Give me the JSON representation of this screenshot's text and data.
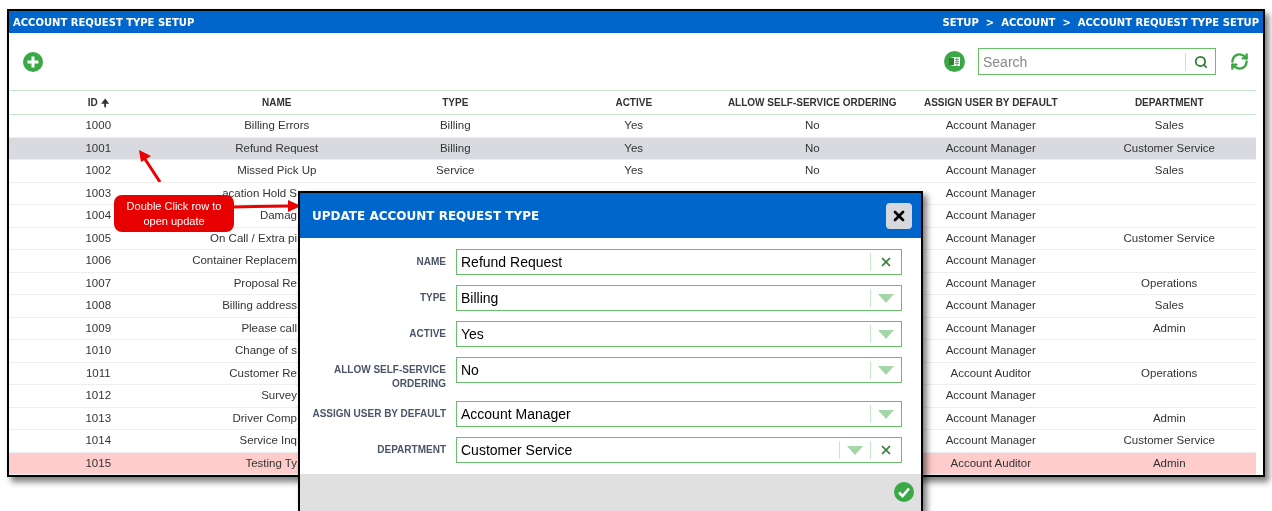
{
  "window": {
    "title": "ACCOUNT REQUEST TYPE SETUP",
    "breadcrumb": [
      "SETUP",
      "ACCOUNT",
      "ACCOUNT REQUEST TYPE SETUP"
    ],
    "separator": ">"
  },
  "search": {
    "placeholder": "Search"
  },
  "table": {
    "columns": [
      {
        "label": "ID",
        "sort_arrow": "🠉"
      },
      {
        "label": "NAME"
      },
      {
        "label": "TYPE"
      },
      {
        "label": "ACTIVE"
      },
      {
        "label": "ALLOW SELF-SERVICE ORDERING"
      },
      {
        "label": "ASSIGN USER BY DEFAULT"
      },
      {
        "label": "DEPARTMENT"
      }
    ],
    "rows": [
      {
        "cells": [
          "1000",
          "Billing Errors",
          "Billing",
          "Yes",
          "No",
          "Account Manager",
          "Sales"
        ],
        "selected": false,
        "alert": false,
        "cut_by_dialog": false
      },
      {
        "cells": [
          "1001",
          "Refund Request",
          "Billing",
          "Yes",
          "No",
          "Account Manager",
          "Customer Service"
        ],
        "selected": true,
        "alert": false,
        "cut_by_dialog": false
      },
      {
        "cells": [
          "1002",
          "Missed Pick Up",
          "Service",
          "Yes",
          "No",
          "Account Manager",
          "Sales"
        ],
        "selected": false,
        "alert": false,
        "cut_by_dialog": false
      },
      {
        "cells": [
          "1003",
          "acation Hold S",
          "",
          "",
          "",
          "Account Manager",
          ""
        ],
        "selected": false,
        "alert": false,
        "cut_by_dialog": true
      },
      {
        "cells": [
          "1004",
          "Damag",
          "",
          "",
          "",
          "Account Manager",
          ""
        ],
        "selected": false,
        "alert": false,
        "cut_by_dialog": true
      },
      {
        "cells": [
          "1005",
          "On Call / Extra pi",
          "",
          "",
          "",
          "Account Manager",
          "Customer Service"
        ],
        "selected": false,
        "alert": false,
        "cut_by_dialog": true
      },
      {
        "cells": [
          "1006",
          "Container Replacem",
          "",
          "",
          "",
          "Account Manager",
          ""
        ],
        "selected": false,
        "alert": false,
        "cut_by_dialog": true
      },
      {
        "cells": [
          "1007",
          "Proposal Re",
          "",
          "",
          "",
          "Account Manager",
          "Operations"
        ],
        "selected": false,
        "alert": false,
        "cut_by_dialog": true
      },
      {
        "cells": [
          "1008",
          "Billing address",
          "",
          "",
          "",
          "Account Manager",
          "Sales"
        ],
        "selected": false,
        "alert": false,
        "cut_by_dialog": true
      },
      {
        "cells": [
          "1009",
          "Please call",
          "",
          "",
          "",
          "Account Manager",
          "Admin"
        ],
        "selected": false,
        "alert": false,
        "cut_by_dialog": true
      },
      {
        "cells": [
          "1010",
          "Change of s",
          "",
          "",
          "",
          "Account Manager",
          ""
        ],
        "selected": false,
        "alert": false,
        "cut_by_dialog": true
      },
      {
        "cells": [
          "1011",
          "Customer Re",
          "",
          "",
          "",
          "Account Auditor",
          "Operations"
        ],
        "selected": false,
        "alert": false,
        "cut_by_dialog": true
      },
      {
        "cells": [
          "1012",
          "Survey",
          "",
          "",
          "",
          "Account Manager",
          ""
        ],
        "selected": false,
        "alert": false,
        "cut_by_dialog": true
      },
      {
        "cells": [
          "1013",
          "Driver Comp",
          "",
          "",
          "",
          "Account Manager",
          "Admin"
        ],
        "selected": false,
        "alert": false,
        "cut_by_dialog": true
      },
      {
        "cells": [
          "1014",
          "Service Inq",
          "",
          "",
          "",
          "Account Manager",
          "Customer Service"
        ],
        "selected": false,
        "alert": false,
        "cut_by_dialog": true
      },
      {
        "cells": [
          "1015",
          "Testing Ty",
          "",
          "",
          "",
          "Account Auditor",
          "Admin"
        ],
        "selected": false,
        "alert": true,
        "cut_by_dialog": true
      }
    ]
  },
  "callout": {
    "text": "Double Click row to open update"
  },
  "dialog": {
    "title": "UPDATE ACCOUNT REQUEST TYPE",
    "fields": [
      {
        "label": "NAME",
        "value": "Refund Request",
        "kind": "text"
      },
      {
        "label": "TYPE",
        "value": "Billing",
        "kind": "select"
      },
      {
        "label": "ACTIVE",
        "value": "Yes",
        "kind": "select"
      },
      {
        "label": "ALLOW SELF-SERVICE ORDERING",
        "value": "No",
        "kind": "select"
      },
      {
        "label": "ASSIGN USER BY DEFAULT",
        "value": "Account Manager",
        "kind": "select"
      },
      {
        "label": "DEPARTMENT",
        "value": "Customer Service",
        "kind": "select_clearable"
      }
    ]
  }
}
